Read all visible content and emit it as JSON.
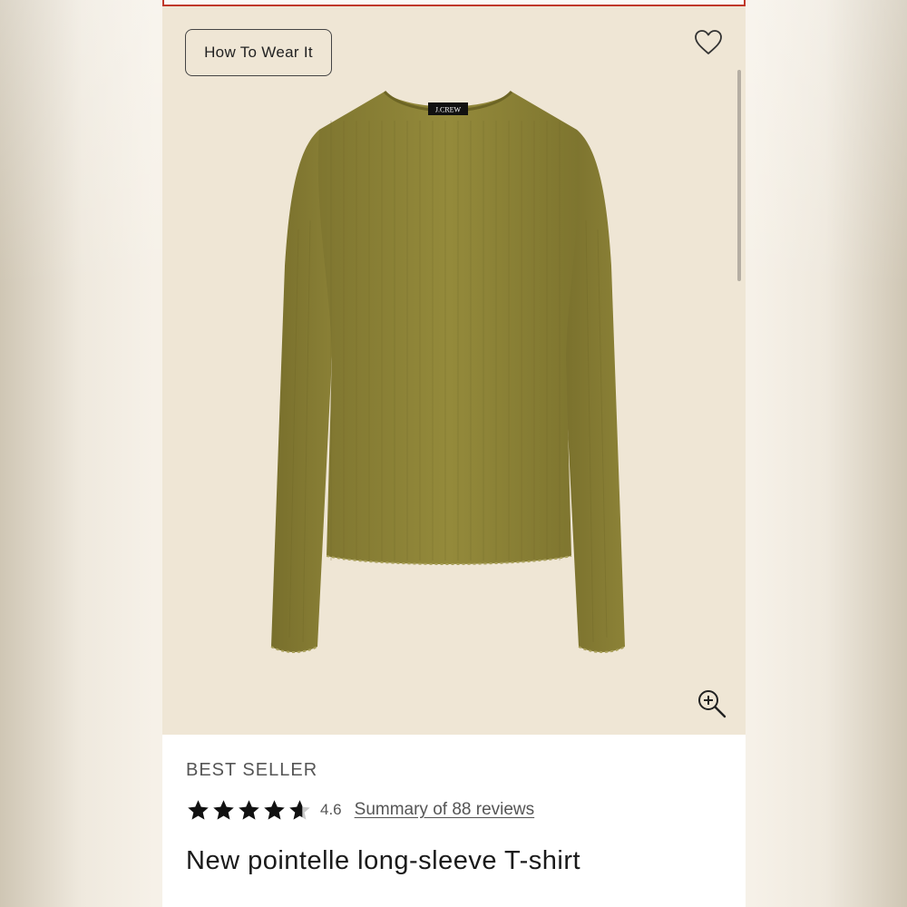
{
  "hero": {
    "how_to_wear_label": "How To Wear It",
    "brand_label": "J.CREW",
    "background_color": "#efe6d5",
    "product_color": "#8f8536"
  },
  "product": {
    "badge": "BEST SELLER",
    "rating": 4.6,
    "rating_text": "4.6",
    "reviews_link": "Summary of 88 reviews",
    "title": "New pointelle long-sleeve T-shirt"
  },
  "icons": {
    "favorite": "heart-icon",
    "zoom": "zoom-in-icon",
    "star": "star-icon"
  }
}
